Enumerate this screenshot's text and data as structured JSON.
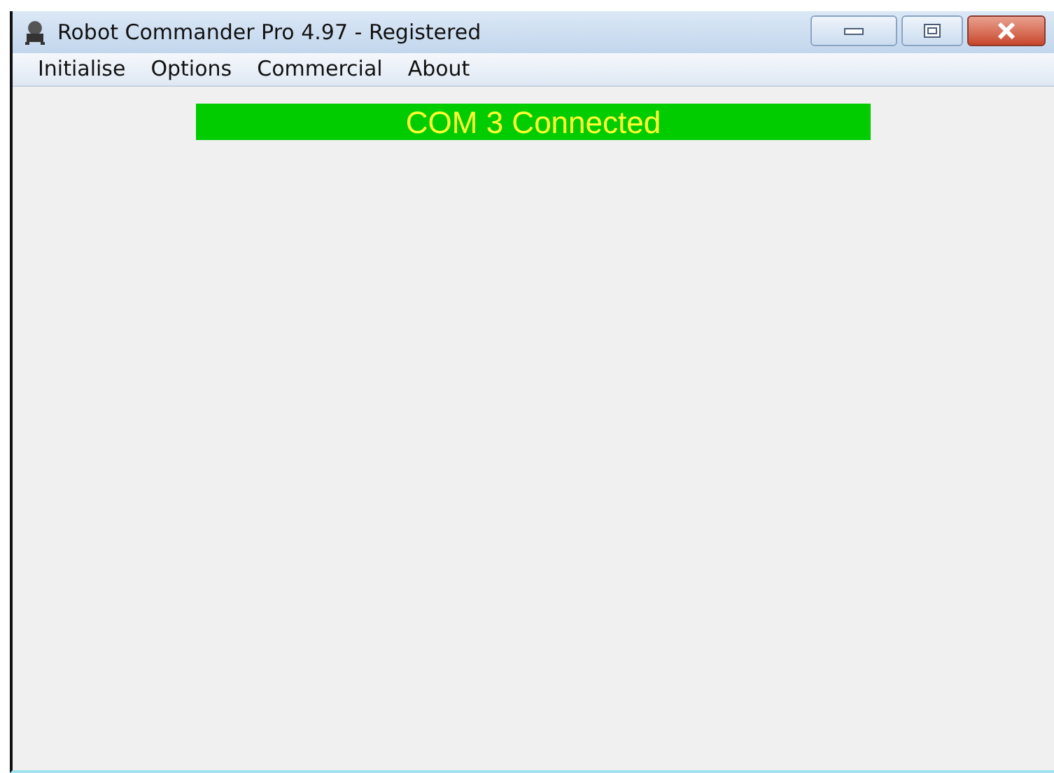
{
  "window": {
    "title": "Robot Commander Pro 4.97 - Registered"
  },
  "menu": [
    {
      "label": "Initialise"
    },
    {
      "label": "Options"
    },
    {
      "label": "Commercial"
    },
    {
      "label": "About"
    }
  ],
  "status": {
    "text": "COM 3 Connected"
  }
}
